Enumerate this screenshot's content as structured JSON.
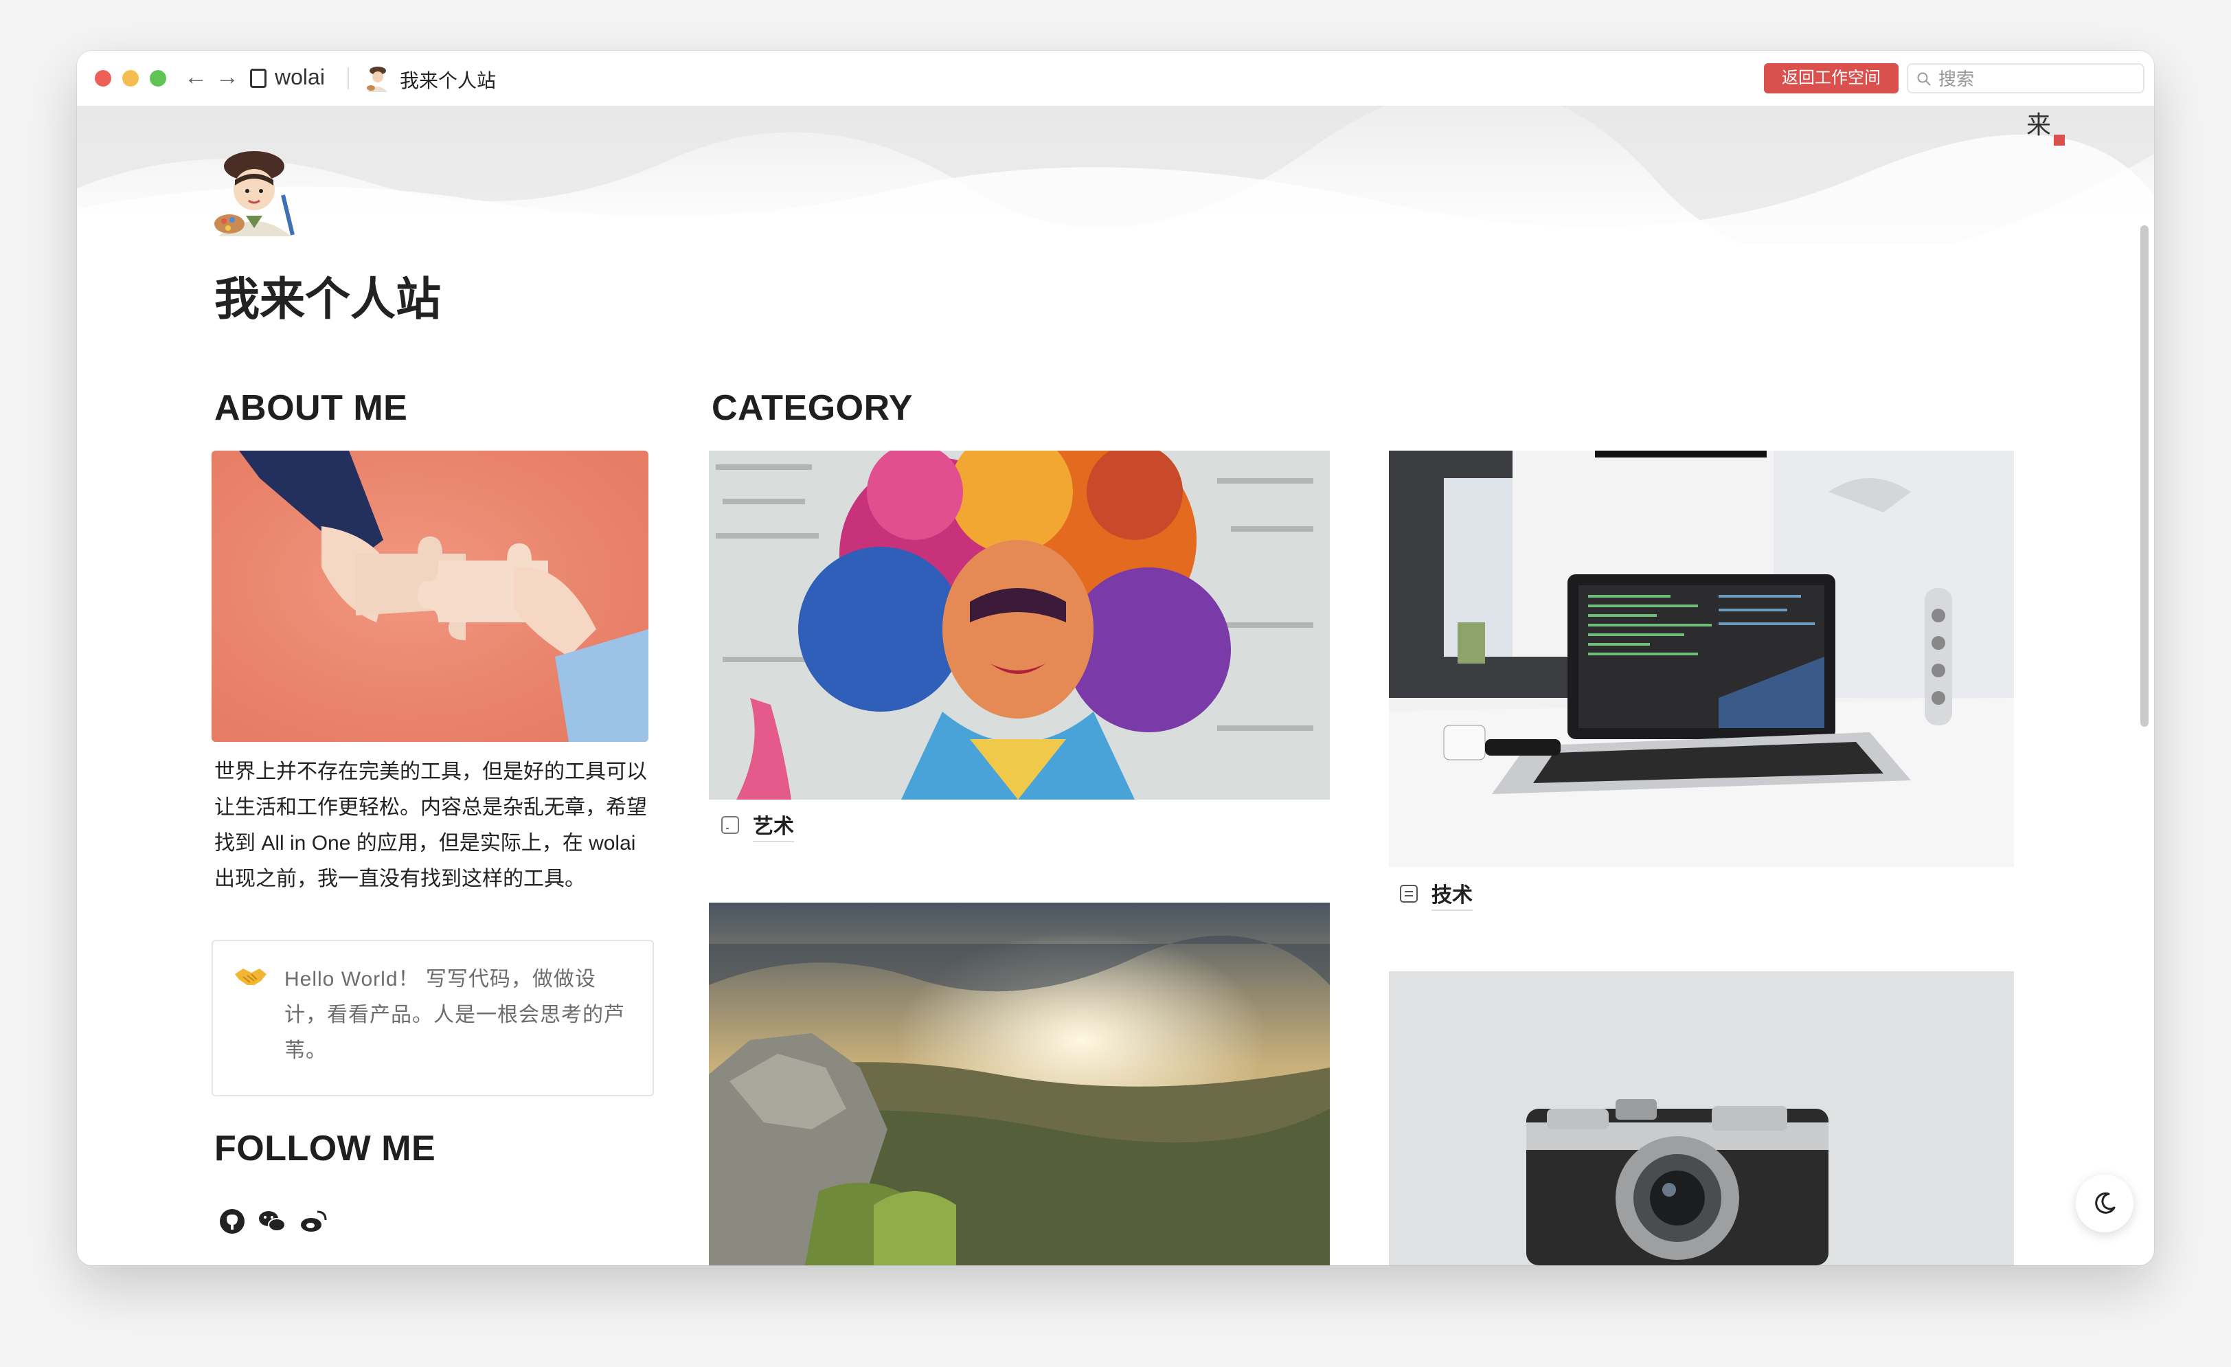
{
  "titlebar": {
    "app_name": "wolai",
    "breadcrumb": "我来个人站",
    "back_workspace_label": "返回工作空间",
    "search_placeholder": "搜索"
  },
  "page": {
    "title": "我来个人站",
    "icon": "artist-emoji-icon"
  },
  "about": {
    "heading": "ABOUT ME",
    "text": "世界上并不存在完美的工具，但是好的工具可以让生活和工作更轻松。内容总是杂乱无章，希望找到 All in One 的应用，但是实际上，在 wolai 出现之前，我一直没有找到这样的工具。",
    "callout_icon": "handshake-icon",
    "callout_text": "Hello World！ 写写代码，做做设计，看看产品。人是一根会思考的芦苇。"
  },
  "category": {
    "heading": "CATEGORY",
    "cards": [
      {
        "label": "艺术",
        "icon": "page-icon",
        "image": "colorful-portrait-painting"
      },
      {
        "label": "技术",
        "icon": "document-icon",
        "image": "laptop-desk"
      },
      {
        "label": "",
        "icon": "",
        "image": "mountain-sunset"
      },
      {
        "label": "",
        "icon": "",
        "image": "vintage-camera"
      }
    ]
  },
  "follow": {
    "heading": "FOLLOW ME",
    "icons": [
      "github-icon",
      "wechat-icon",
      "weibo-icon"
    ]
  },
  "colors": {
    "accent": "#d9504d",
    "text": "#222222",
    "muted": "#6d6d6d"
  }
}
